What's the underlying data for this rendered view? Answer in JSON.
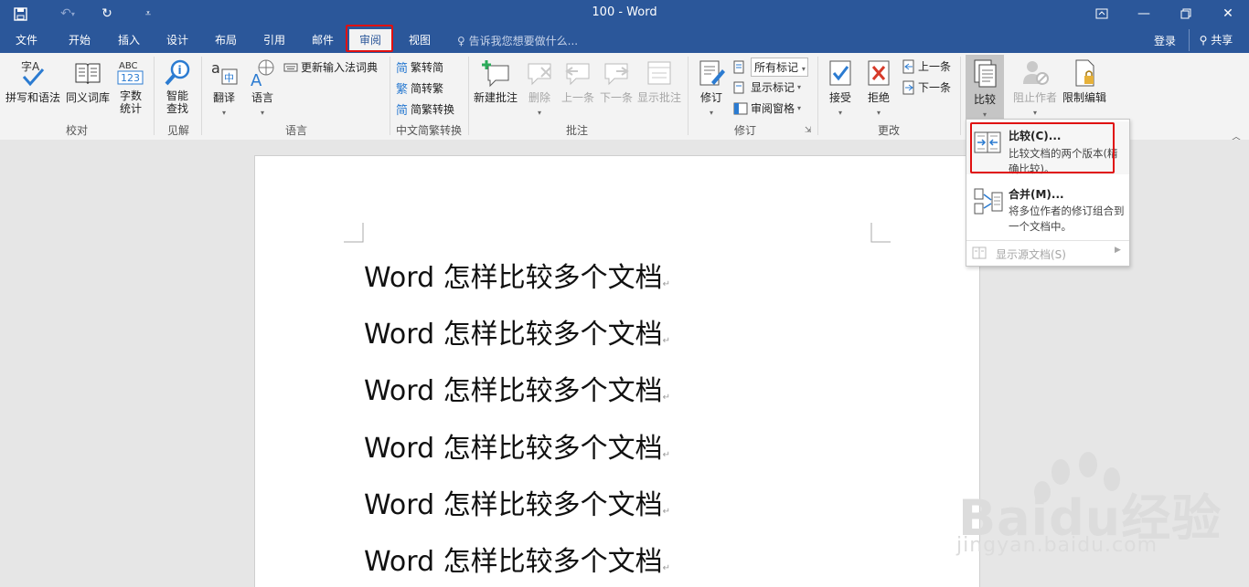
{
  "window": {
    "title": "100 - Word"
  },
  "tabs": [
    {
      "label": "文件"
    },
    {
      "label": "开始"
    },
    {
      "label": "插入"
    },
    {
      "label": "设计"
    },
    {
      "label": "布局"
    },
    {
      "label": "引用"
    },
    {
      "label": "邮件"
    },
    {
      "label": "审阅"
    },
    {
      "label": "视图"
    }
  ],
  "tellme": "告诉我您想要做什么...",
  "account": {
    "login": "登录",
    "share": "共享"
  },
  "ribbon": {
    "proofing": {
      "spell": "拼写和语法",
      "thesaurus": "同义词库",
      "wordcount": "字数\n统计",
      "wordcount_icon_text": "ABC\n123",
      "spell_icon_text": "字A",
      "group": "校对"
    },
    "insights": {
      "smart": "智能\n查找",
      "group": "见解"
    },
    "language": {
      "translate": "翻译",
      "language": "语言",
      "ime": "更新输入法词典",
      "group": "语言"
    },
    "chinese": {
      "t2s": "繁转简",
      "s2t": "简转繁",
      "conv": "简繁转换",
      "group": "中文简繁转换",
      "t2s_icon": "简",
      "s2t_icon": "繁",
      "conv_icon": "简"
    },
    "comments": {
      "new": "新建批注",
      "delete": "删除",
      "prev": "上一条",
      "next": "下一条",
      "show": "显示批注",
      "group": "批注"
    },
    "tracking": {
      "track": "修订",
      "markup_select": "所有标记",
      "show_markup": "显示标记",
      "pane": "审阅窗格",
      "group": "修订"
    },
    "changes": {
      "accept": "接受",
      "reject": "拒绝",
      "prev": "上一条",
      "next": "下一条",
      "group": "更改"
    },
    "compare": {
      "compare": "比较",
      "block": "阻止作者",
      "restrict": "限制编辑"
    }
  },
  "compare_menu": {
    "compare": {
      "title": "比较(C)...",
      "desc": "比较文档的两个版本(精确比较)。"
    },
    "combine": {
      "title": "合并(M)...",
      "desc": "将多位作者的修订组合到一个文档中。"
    },
    "show_source": {
      "title": "显示源文档(S)"
    }
  },
  "document": {
    "lines": [
      "Word 怎样比较多个文档",
      "Word 怎样比较多个文档",
      "Word 怎样比较多个文档",
      "Word 怎样比较多个文档",
      "Word 怎样比较多个文档",
      "Word 怎样比较多个文档"
    ],
    "para_mark": "↵"
  },
  "watermark": {
    "brand": "Baidu经验",
    "url": "jingyan.baidu.com"
  },
  "colors": {
    "title_bar": "#2b579a",
    "ribbon": "#f3f3f3",
    "highlight": "#e01010",
    "accent": "#2b579a"
  }
}
